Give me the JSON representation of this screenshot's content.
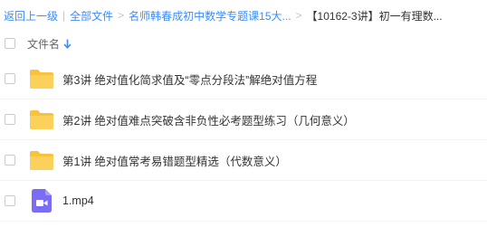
{
  "breadcrumb": {
    "back_label": "返回上一级",
    "divider": "|",
    "all_files_label": "全部文件",
    "separator": ">",
    "folder_1": "名师韩春成初中数学专题课15大...",
    "folder_2": "【10162-3讲】初一有理数..."
  },
  "list_header": {
    "name_column": "文件名",
    "sort_icon": "arrow-down-icon"
  },
  "files": [
    {
      "name": "第3讲 绝对值化简求值及“零点分段法”解绝对值方程",
      "type": "folder",
      "icon": "folder-icon"
    },
    {
      "name": "第2讲 绝对值难点突破含非负性必考题型练习（几何意义）",
      "type": "folder",
      "icon": "folder-icon"
    },
    {
      "name": "第1讲 绝对值常考易错题型精选（代数意义）",
      "type": "folder",
      "icon": "folder-icon"
    },
    {
      "name": "1.mp4",
      "type": "video",
      "icon": "video-file-icon"
    }
  ],
  "colors": {
    "link": "#3b8cff",
    "folder": "#f9c23c",
    "video": "#7a6cf5"
  }
}
